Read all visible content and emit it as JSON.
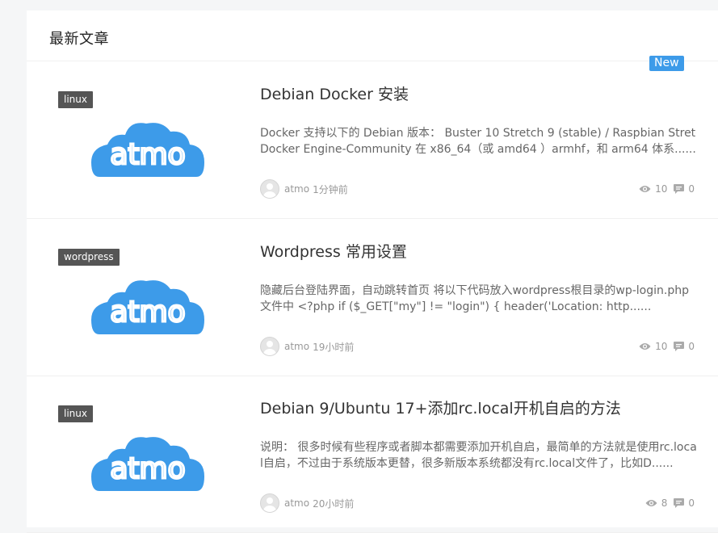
{
  "section": {
    "title": "最新文章"
  },
  "badge": {
    "new_label": "New"
  },
  "posts": [
    {
      "category": "linux",
      "logo_text": "atmo",
      "title": "Debian Docker 安装",
      "excerpt_lines": [
        "Docker 支持以下的 Debian 版本： Buster 10 Stretch 9 (stable) / Raspbian Stretch",
        "Docker Engine-Community 在 x86_64（或 amd64 ）armhf，和 arm64 体系......"
      ],
      "author": "atmo",
      "time": "1分钟前",
      "views": "10",
      "comments": "0"
    },
    {
      "category": "wordpress",
      "logo_text": "atmo",
      "title": "Wordpress 常用设置",
      "excerpt_lines": [
        "隐藏后台登陆界面，自动跳转首页 将以下代码放入wordpress根目录的wp-login.php",
        "文件中 <?php if ($_GET[\"my\"] != \"login\") { header('Location: http......"
      ],
      "author": "atmo",
      "time": "19小时前",
      "views": "10",
      "comments": "0"
    },
    {
      "category": "linux",
      "logo_text": "atmo",
      "title": "Debian 9/Ubuntu 17+添加rc.local开机自启的方法",
      "excerpt_lines": [
        "说明： 很多时候有些程序或者脚本都需要添加开机自启，最简单的方法就是使用rc.local",
        "l自启，不过由于系统版本更替，很多新版本系统都没有rc.local文件了，比如D......"
      ],
      "author": "atmo",
      "time": "20小时前",
      "views": "8",
      "comments": "0"
    }
  ],
  "colors": {
    "logo_blue": "#3d9be9",
    "tag_bg": "#555555",
    "badge_bg": "#3d9be9"
  },
  "icons": {
    "views": "eye-icon",
    "comments": "comment-icon",
    "author": "avatar-icon"
  }
}
